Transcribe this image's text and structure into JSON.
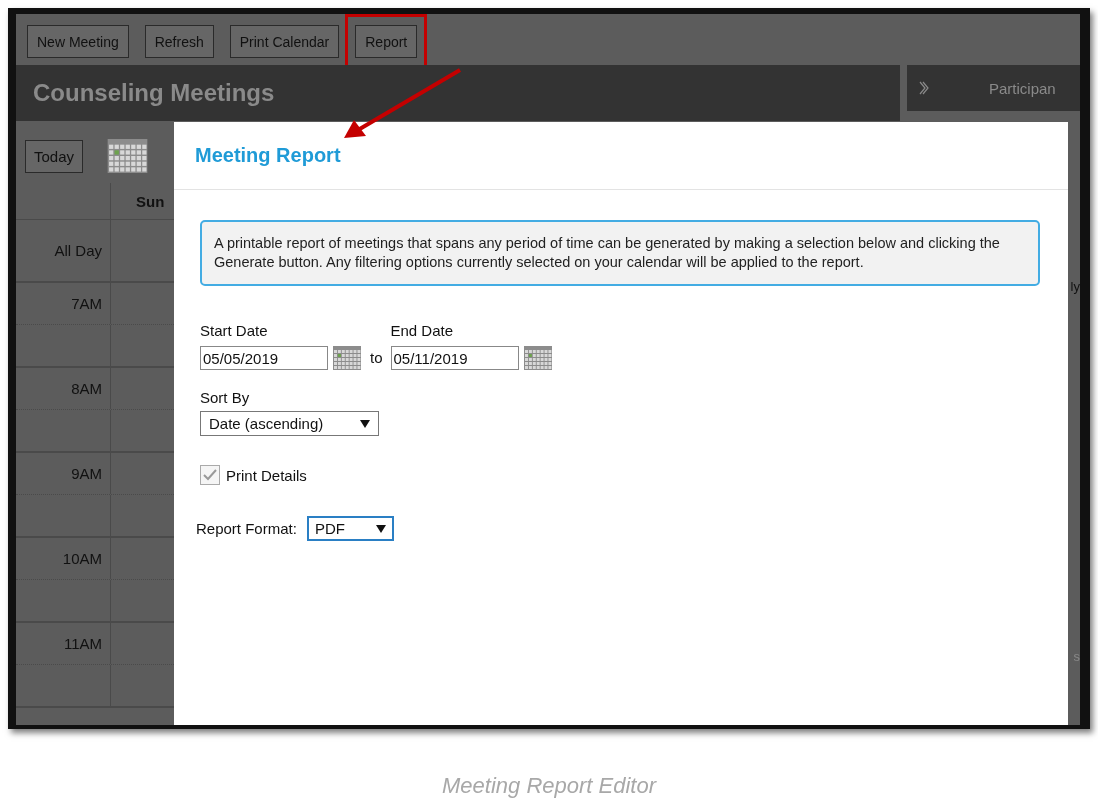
{
  "toolbar": {
    "buttons": [
      {
        "label": "New Meeting",
        "highlighted": false
      },
      {
        "label": "Refresh",
        "highlighted": false
      },
      {
        "label": "Print Calendar",
        "highlighted": false
      },
      {
        "label": "Report",
        "highlighted": true
      }
    ]
  },
  "calendar": {
    "title": "Counseling Meetings",
    "today_button": "Today",
    "day_header": "Sun",
    "rows": [
      {
        "time": "All Day",
        "kind": "allday"
      },
      {
        "time": "7AM",
        "kind": "hour"
      },
      {
        "time": "8AM",
        "kind": "hour"
      },
      {
        "time": "9AM",
        "kind": "hour"
      },
      {
        "time": "10AM",
        "kind": "hour"
      },
      {
        "time": "11AM",
        "kind": "hour"
      }
    ]
  },
  "side_panel": {
    "title": "Participan",
    "fragments": [
      "ly",
      "s"
    ]
  },
  "dialog": {
    "title": "Meeting Report",
    "info": "A printable report of meetings that spans any period of time can be generated by making a selection below and clicking the Generate button. Any filtering options currently selected on your calendar will be applied to the report.",
    "start_date": {
      "label": "Start Date",
      "value": "05/05/2019"
    },
    "range_word": "to",
    "end_date": {
      "label": "End Date",
      "value": "05/11/2019"
    },
    "sort_by": {
      "label": "Sort By",
      "value": "Date (ascending)"
    },
    "print_details": {
      "label": "Print Details",
      "checked": true
    },
    "report_format": {
      "label": "Report Format:",
      "value": "PDF"
    }
  },
  "caption": "Meeting Report Editor"
}
